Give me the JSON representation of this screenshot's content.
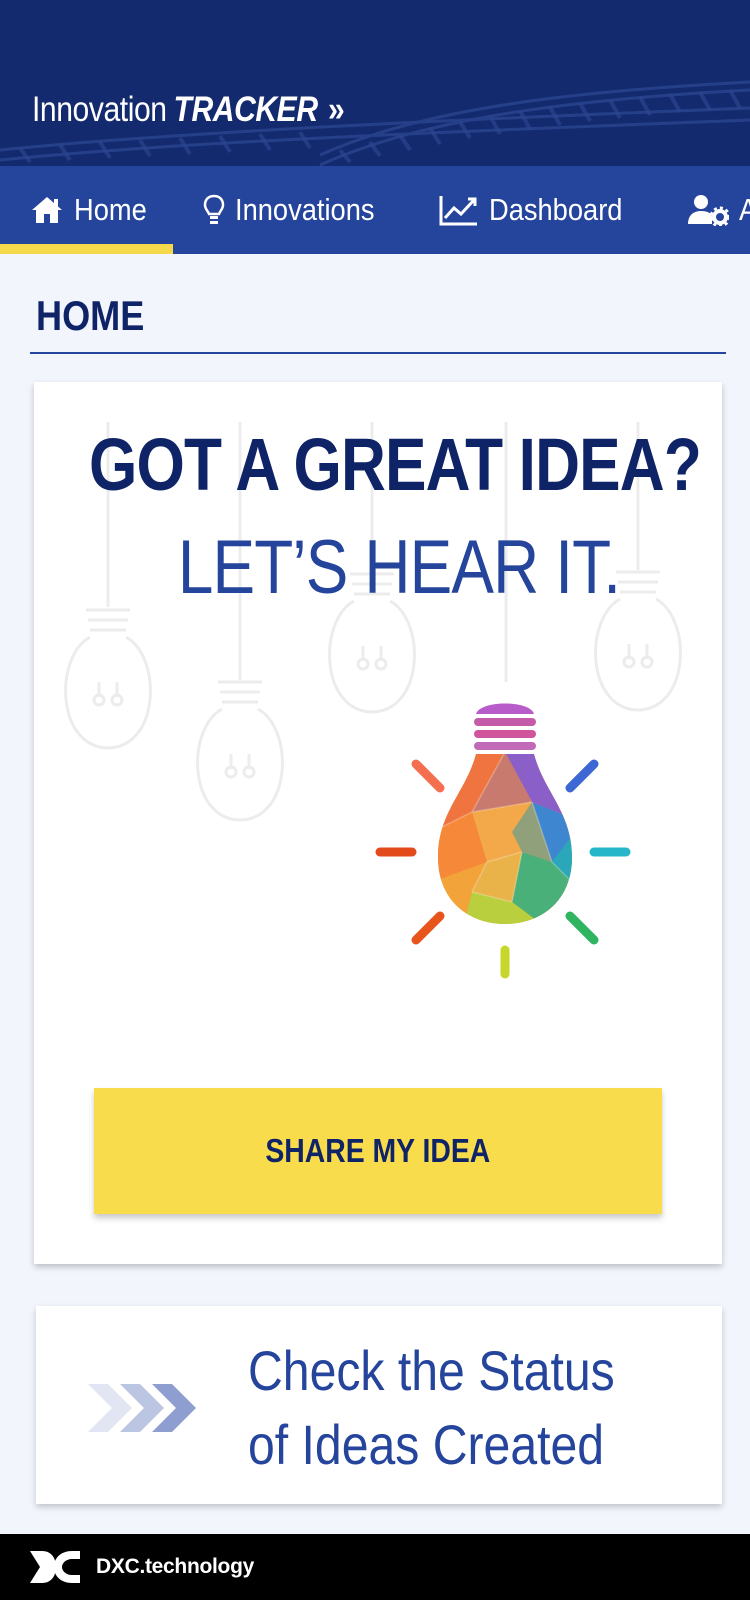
{
  "header": {
    "brand_regular": "Innovation",
    "brand_bold": "TRACKER",
    "brand_chevrons": "»"
  },
  "nav": {
    "items": [
      {
        "label": "Home",
        "icon": "home-icon",
        "active": true
      },
      {
        "label": "Innovations",
        "icon": "lightbulb-icon",
        "active": false
      },
      {
        "label": "Dashboard",
        "icon": "chart-line-icon",
        "active": false
      },
      {
        "label": "Admin",
        "icon": "user-gear-icon",
        "active": false
      }
    ],
    "active_underline_color": "#f6d94a"
  },
  "page": {
    "title": "HOME"
  },
  "hero": {
    "headline_line1": "GOT A GREAT IDEA?",
    "headline_line2": "LET’S HEAR IT.",
    "illustration": "colorful-lightbulb",
    "cta_label": "SHARE MY IDEA"
  },
  "status_card": {
    "line1": "Check the Status",
    "line2": "of Ideas Created",
    "icon": "triple-chevron-icon"
  },
  "footer": {
    "logo_text": "DXC.technology"
  },
  "colors": {
    "header_bg": "#132a6e",
    "nav_bg": "#25449c",
    "accent_yellow": "#f8dc4c",
    "primary_text": "#0f2367"
  }
}
